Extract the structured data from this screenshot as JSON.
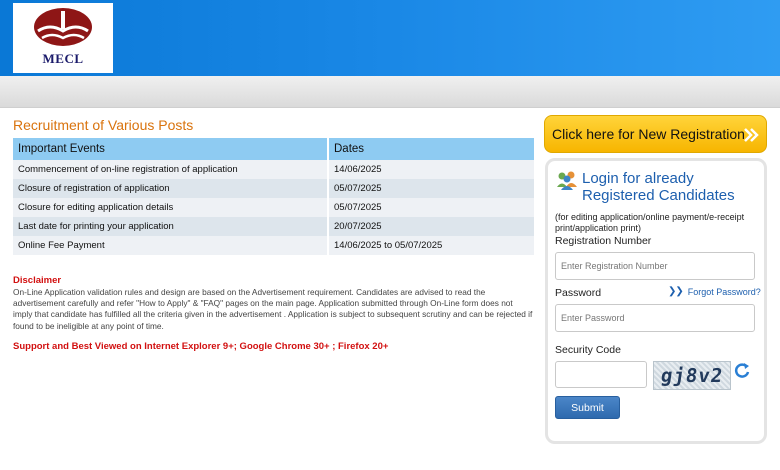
{
  "header": {
    "logo_text": "MECL",
    "colors": {
      "header_blue": "#1a88e6",
      "accent_orange": "#d9730d",
      "button_yellow": "#f7b500"
    }
  },
  "main": {
    "title": "Recruitment of Various Posts",
    "table": {
      "headers": [
        "Important Events",
        "Dates"
      ],
      "rows": [
        {
          "event": "Commencement of on-line registration of application",
          "date": "14/06/2025"
        },
        {
          "event": "Closure of registration of application",
          "date": "05/07/2025"
        },
        {
          "event": "Closure for editing application details",
          "date": "05/07/2025"
        },
        {
          "event": "Last date for printing your application",
          "date": "20/07/2025"
        },
        {
          "event": "Online Fee Payment",
          "date": "14/06/2025 to 05/07/2025"
        }
      ]
    },
    "disclaimer_title": "Disclaimer",
    "disclaimer_text": "On-Line Application validation rules and design are based on the Advertisement requirement. Candidates are advised to read the advertisement carefully and refer \"How to Apply\" & \"FAQ\" pages on the main page. Application submitted through On-Line form does not imply that candidate has fulfilled all the criteria given in the advertisement . Application is subject to subsequent scrutiny and can be rejected if found to be ineligible at any point of time.",
    "support_text": "Support and Best Viewed on Internet Explorer 9+; Google Chrome 30+ ; Firefox 20+"
  },
  "sidebar": {
    "new_registration_label": "Click here for New Registration",
    "login_title_line1": "Login for already",
    "login_title_line2": "Registered Candidates",
    "login_subtitle": "(for editing application/online payment/e-receipt print/application print)",
    "registration_label": "Registration Number",
    "registration_placeholder": "Enter Registration Number",
    "password_label": "Password",
    "forgot_password": "Forgot Password?",
    "password_placeholder": "Enter Password",
    "security_code_label": "Security Code",
    "captcha_text": "gj8v2",
    "submit_label": "Submit",
    "icons": {
      "login": "users-icon",
      "refresh": "refresh-icon",
      "arrows": "double-chevron-right-icon"
    }
  }
}
